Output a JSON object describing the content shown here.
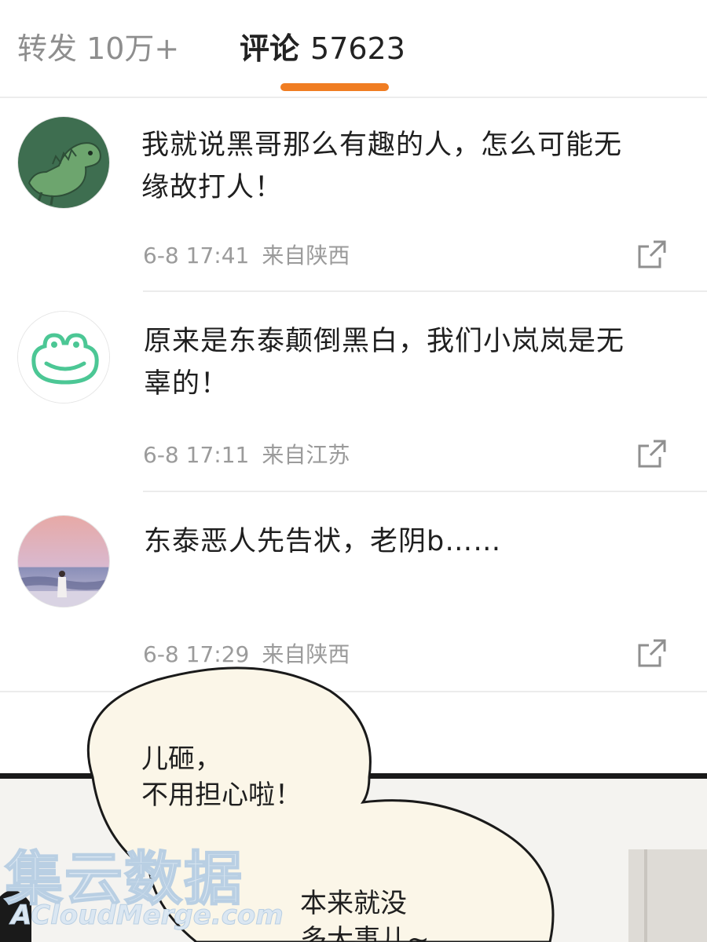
{
  "tabs": {
    "repost": "转发 10万+",
    "comment_label": "评论",
    "comment_count": "57623",
    "accent_color": "#f07d22"
  },
  "comments": [
    {
      "avatar": "green-dinosaur-avatar",
      "text": "我就说黑哥那么有趣的人，怎么可能无缘故打人！",
      "time": "6-8 17:41",
      "location": "来自陕西",
      "action_icon": "share-icon"
    },
    {
      "avatar": "frog-face-avatar",
      "text": "原来是东泰颠倒黑白，我们小岚岚是无辜的！",
      "time": "6-8 17:11",
      "location": "来自江苏",
      "action_icon": "share-icon"
    },
    {
      "avatar": "beach-sunset-avatar",
      "text": "东泰恶人先告状，老阴b……",
      "time": "6-8 17:29",
      "location": "来自陕西",
      "action_icon": "share-icon"
    }
  ],
  "comic": {
    "bubble1_line1": "儿砸，",
    "bubble1_line2": "不用担心啦！",
    "bubble2_line1": "本来就没",
    "bubble2_line2": "多大事儿~",
    "bubble_color": "#fbf6e8"
  },
  "watermark": {
    "logo": "集云数据",
    "url": "ACloudMerge.com"
  }
}
